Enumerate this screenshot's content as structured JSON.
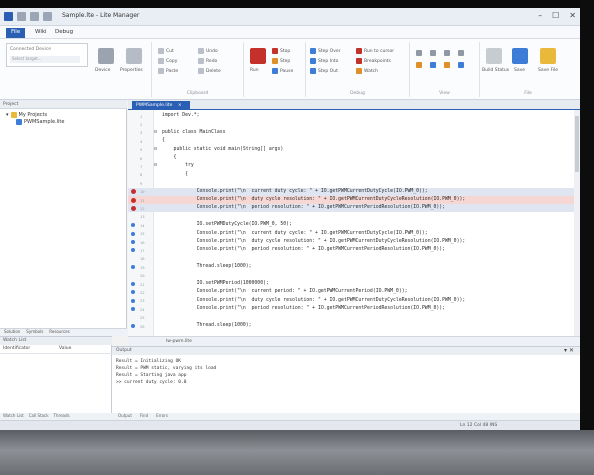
{
  "window": {
    "title": "Sample.lte - Lite Manager",
    "controls": [
      "–",
      "☐",
      "✕"
    ]
  },
  "ribbon_tabs": [
    "File",
    "Wiki",
    "Debug"
  ],
  "ribbon": {
    "device_label": "Connected Device",
    "device_value": "Select target...",
    "groups": [
      {
        "label": "",
        "buttons": [
          "Device",
          "Properties"
        ]
      },
      {
        "label": "Clipboard",
        "buttons": [
          "Cut",
          "Copy",
          "Paste",
          "Undo",
          "Redo",
          "Delete"
        ]
      },
      {
        "label": "",
        "buttons": [
          "Run",
          "Stop",
          "Step",
          "Pause"
        ]
      },
      {
        "label": "Debug",
        "buttons": [
          "Step Over",
          "Step Into",
          "Step Out",
          "Run to cursor",
          "Breakpoints",
          "Watch"
        ]
      },
      {
        "label": "View",
        "buttons": []
      },
      {
        "label": "File",
        "buttons": [
          "Build Status",
          "Save",
          "Save File"
        ]
      }
    ],
    "colors": {
      "file_tab": "#2b5fb4",
      "accent_orange": "#e0902b",
      "accent_red": "#c4312b",
      "accent_blue": "#3d7dd8"
    }
  },
  "left_pane": {
    "header": "Project",
    "tree_root": "My Projects",
    "tree_child": "PWMSample.lite",
    "bottom_tabs": [
      "Solution",
      "Symbols",
      "Resources"
    ]
  },
  "editor": {
    "tab_label": "PWMSample.lite",
    "tab_close": "×",
    "second_tab": "lw-pwm.lite",
    "lines": [
      {
        "num": "1",
        "code": "import Dev.*;",
        "marker": "none",
        "hl": ""
      },
      {
        "num": "2",
        "code": "",
        "marker": "none",
        "hl": ""
      },
      {
        "num": "3",
        "code": "public class MainClass",
        "marker": "fold",
        "hl": ""
      },
      {
        "num": "4",
        "code": "{",
        "marker": "none",
        "hl": ""
      },
      {
        "num": "5",
        "code": "    public static void main(String[] args)",
        "marker": "fold",
        "hl": ""
      },
      {
        "num": "6",
        "code": "    {",
        "marker": "none",
        "hl": ""
      },
      {
        "num": "7",
        "code": "        try",
        "marker": "fold",
        "hl": ""
      },
      {
        "num": "8",
        "code": "        {",
        "marker": "none",
        "hl": ""
      },
      {
        "num": "9",
        "code": "",
        "marker": "none",
        "hl": ""
      },
      {
        "num": "10",
        "code": "            Console.print(\"\\n  current duty cycle: \" + IO.getPWMCurrentDutyCycle(IO.PWM_0));",
        "marker": "bp",
        "hl": "hl2"
      },
      {
        "num": "11",
        "code": "            Console.print(\"\\n  duty cycle resolution: \" + IO.getPWMCurrentDutyCycleResolution(IO.PWM_0));",
        "marker": "bp",
        "hl": "hl"
      },
      {
        "num": "12",
        "code": "            Console.print(\"\\n  period resolution: \" + IO.getPWMCurrentPeriodResolution(IO.PWM_0));",
        "marker": "bp",
        "hl": "hl2"
      },
      {
        "num": "13",
        "code": "",
        "marker": "none",
        "hl": ""
      },
      {
        "num": "14",
        "code": "            IO.setPWMDutyCycle(IO.PWM_0, 50);",
        "marker": "mk",
        "hl": ""
      },
      {
        "num": "15",
        "code": "            Console.print(\"\\n  current duty cycle: \" + IO.getPWMCurrentDutyCycle(IO.PWM_0));",
        "marker": "mk",
        "hl": ""
      },
      {
        "num": "16",
        "code": "            Console.print(\"\\n  duty cycle resolution: \" + IO.getPWMCurrentDutyCycleResolution(IO.PWM_0));",
        "marker": "mk",
        "hl": ""
      },
      {
        "num": "17",
        "code": "            Console.print(\"\\n  period resolution: \" + IO.getPWMCurrentPeriodResolution(IO.PWM_0));",
        "marker": "mk",
        "hl": ""
      },
      {
        "num": "18",
        "code": "",
        "marker": "none",
        "hl": ""
      },
      {
        "num": "19",
        "code": "            Thread.sleep(1000);",
        "marker": "mk",
        "hl": ""
      },
      {
        "num": "20",
        "code": "",
        "marker": "none",
        "hl": ""
      },
      {
        "num": "21",
        "code": "            IO.setPWMPeriod(1000000);",
        "marker": "mk",
        "hl": ""
      },
      {
        "num": "22",
        "code": "            Console.print(\"\\n  current period: \" + IO.getPWMCurrentPeriod(IO.PWM_0));",
        "marker": "mk",
        "hl": ""
      },
      {
        "num": "23",
        "code": "            Console.print(\"\\n  duty cycle resolution: \" + IO.getPWMCurrentDutyCycleResolution(IO.PWM_0));",
        "marker": "mk",
        "hl": ""
      },
      {
        "num": "24",
        "code": "            Console.print(\"\\n  period resolution: \" + IO.getPWMCurrentPeriodResolution(IO.PWM_0));",
        "marker": "mk",
        "hl": ""
      },
      {
        "num": "25",
        "code": "",
        "marker": "none",
        "hl": ""
      },
      {
        "num": "26",
        "code": "            Thread.sleep(1000);",
        "marker": "mk",
        "hl": ""
      }
    ],
    "bottom_tab": "Output"
  },
  "lower_left": {
    "header": "Watch List",
    "col1": "Identificator",
    "col2": "Value",
    "tabs": [
      "Watch List",
      "Call Stack",
      "Threads"
    ]
  },
  "output": {
    "header": "Output",
    "pin": "▾ ✕",
    "lines": [
      "Result = Initializing OK",
      "Result = PWM static, varying its load",
      "Result = Starting java app",
      ">> current duty cycle: 0.0"
    ],
    "tabs": [
      "Output",
      "Find",
      "Errors"
    ]
  },
  "status": {
    "text": "Ln 12   Col 48   INS"
  }
}
